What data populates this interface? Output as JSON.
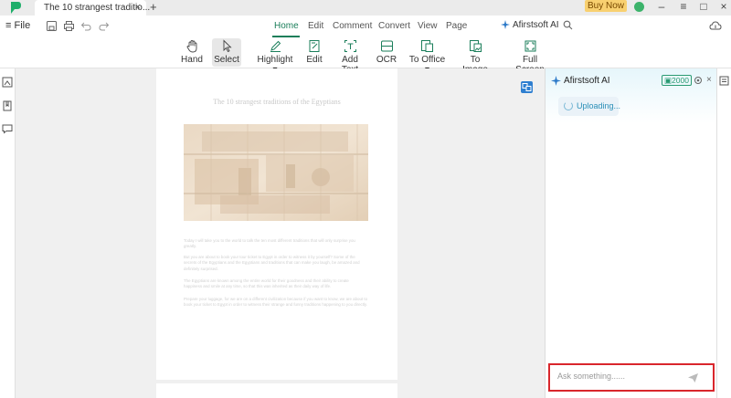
{
  "titlebar": {
    "tab_title": "The 10 strangest traditio...",
    "tab_close": "×",
    "tab_add": "+",
    "buy_now": "Buy Now",
    "minimize": "–",
    "menu": "≡",
    "maximize": "□",
    "close": "×"
  },
  "menubar": {
    "file": "≡ File",
    "tabs": [
      "Home",
      "Edit",
      "Comment",
      "Convert",
      "View",
      "Page"
    ],
    "active_tab": "Home",
    "ai_label": "Afirstsoft AI"
  },
  "toolbar": {
    "tools": [
      {
        "label": "Hand",
        "icon": "hand-icon"
      },
      {
        "label": "Select",
        "icon": "cursor-icon"
      },
      {
        "label": "Highlight ▾",
        "icon": "highlight-pen-icon"
      },
      {
        "label": "Edit",
        "icon": "edit-icon"
      },
      {
        "label": "Add Text",
        "icon": "add-text-icon"
      },
      {
        "label": "OCR",
        "icon": "ocr-icon"
      },
      {
        "label": "To Office ▾",
        "icon": "to-office-icon"
      },
      {
        "label": "To Image",
        "icon": "to-image-icon"
      },
      {
        "label": "Full Screen",
        "icon": "full-screen-icon"
      }
    ]
  },
  "document": {
    "title": "The 10 strangest traditions of the Egyptians",
    "paragraphs": [
      "Today I will take you to the world to talk the ten most different traditions that will only surprise you greatly.",
      "But you are about to book your tour ticket to Egypt in order to witness it by yourself? Some of the secrets of the Egyptians and the Egyptians and traditions that can make you laugh, be amazed and definitely surprised.",
      "The Egyptians are known among the entire world for their goodness and their ability to create happiness and smile at any time, so that this was inherited as their daily way of life.",
      "Prepare your luggage, for we are on a different civilization because if you want to know, we are about to book your ticket to Egypt in order to witness their strange and funny traditions happening to you directly."
    ]
  },
  "ai_panel": {
    "title": "Afirstsoft AI",
    "credits": "2000",
    "uploading": "Uploading...",
    "ask_placeholder": "Ask something......"
  },
  "colors": {
    "accent": "#1a7e5a",
    "buy_now_bg": "#f8d070",
    "highlight_border": "#d9262c",
    "upload_text": "#2a8fb7"
  }
}
